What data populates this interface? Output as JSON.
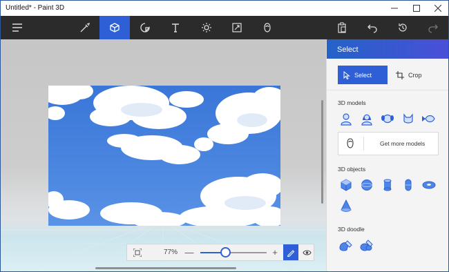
{
  "window": {
    "title": "Untitled* - Paint 3D",
    "controls": [
      "minimize",
      "maximize",
      "close"
    ]
  },
  "toolbar": {
    "left": [
      "menu-icon"
    ],
    "tools": [
      "brushes-icon",
      "3d-shapes-icon",
      "stickers-icon",
      "text-icon",
      "effects-icon",
      "canvas-icon",
      "3d-library-icon"
    ],
    "active_tool": "3d-shapes-icon",
    "right": [
      "paste-icon",
      "undo-icon",
      "history-icon",
      "redo-icon"
    ]
  },
  "canvas": {
    "image": "sky-with-clouds"
  },
  "zoom": {
    "percent_label": "77%",
    "minus": "—",
    "plus": "+",
    "level": 0.37
  },
  "panel": {
    "title": "Select",
    "select_label": "Select",
    "crop_label": "Crop",
    "sections": {
      "models": {
        "label": "3D models",
        "items": [
          "man-model-icon",
          "woman-model-icon",
          "dog-model-icon",
          "cat-model-icon",
          "fish-model-icon"
        ]
      },
      "more": {
        "label": "Get more models",
        "icon": "3d-library-icon"
      },
      "objects": {
        "label": "3D objects",
        "items": [
          "cube-icon",
          "sphere-icon",
          "cylinder-icon",
          "capsule-icon",
          "donut-icon",
          "cone-icon"
        ]
      },
      "doodle": {
        "label": "3D doodle",
        "items": [
          "sharp-doodle-icon",
          "soft-doodle-icon"
        ]
      }
    }
  },
  "colors": {
    "accent": "#2e5fd6",
    "toolbar_bg": "#2b2b2b",
    "panel_bg": "#f4f4f4"
  }
}
